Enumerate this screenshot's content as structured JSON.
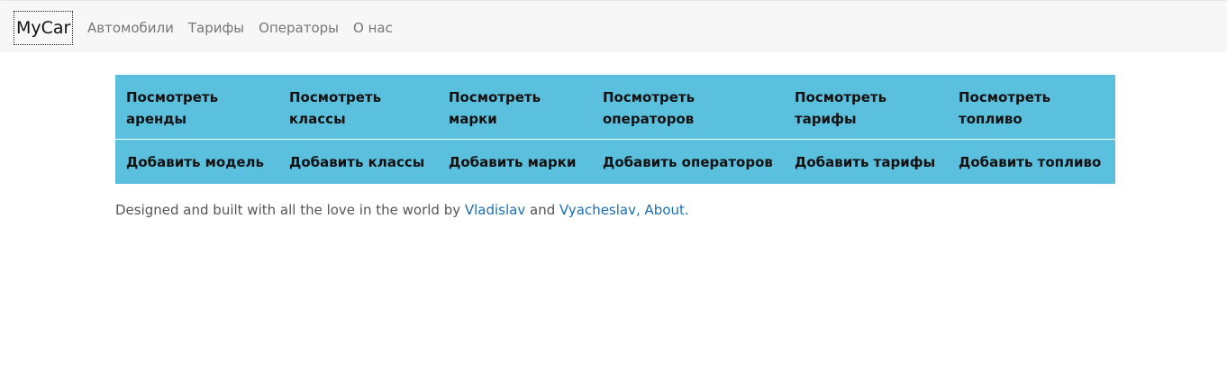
{
  "navbar": {
    "brand": "MyCar",
    "links": [
      "Автомобили",
      "Тарифы",
      "Операторы",
      "О нас"
    ]
  },
  "grid": {
    "view": [
      {
        "line1": "Посмотреть",
        "line2": "аренды"
      },
      {
        "line1": "Посмотреть",
        "line2": "классы"
      },
      {
        "line1": "Посмотреть",
        "line2": "марки"
      },
      {
        "line1": "Посмотреть",
        "line2": "операторов"
      },
      {
        "line1": "Посмотреть",
        "line2": "тарифы"
      },
      {
        "line1": "Посмотреть",
        "line2": "топливо"
      }
    ],
    "add": [
      "Добавить модель",
      "Добавить классы",
      "Добавить марки",
      "Добавить операторов",
      "Добавить тарифы",
      "Добавить топливо"
    ]
  },
  "footer": {
    "text_before": "Designed and built with all the love in the world by ",
    "link1": "Vladislav",
    "text_middle": " and ",
    "link2": "Vyacheslav,",
    "text_space": " ",
    "link3": "About."
  },
  "colors": {
    "navbar_bg": "#f7f7f7",
    "grid_bg": "#5bc0de",
    "link": "#1a6fb3"
  }
}
